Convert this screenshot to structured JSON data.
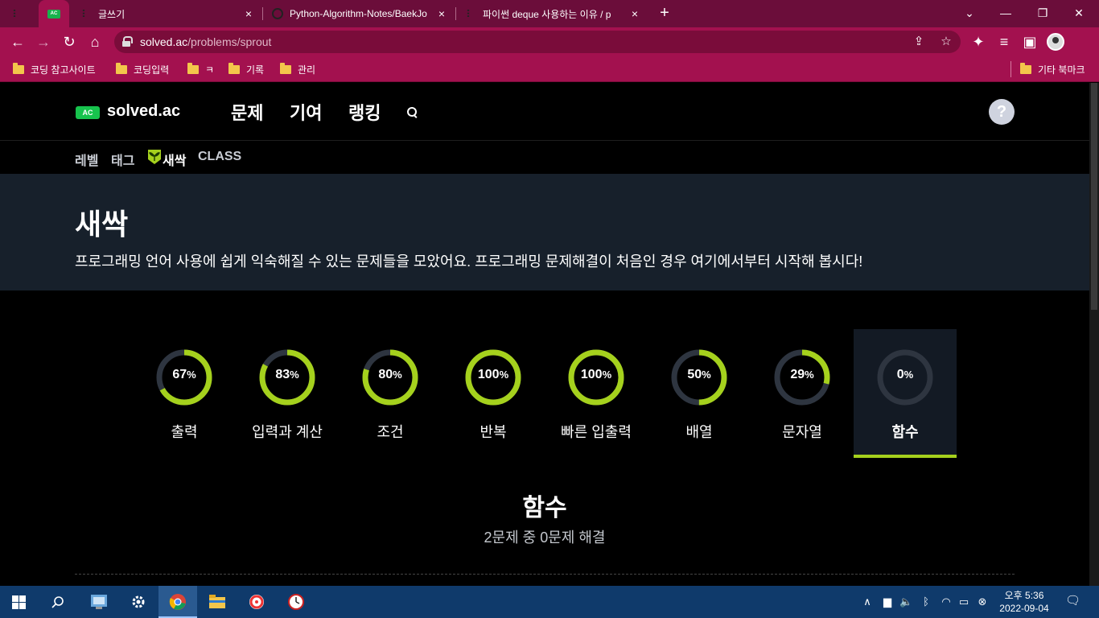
{
  "browser": {
    "tabs": [
      {
        "title": "",
        "favicon": "tistory-icon"
      },
      {
        "title": "",
        "favicon": "solvedac-icon",
        "active": true
      },
      {
        "title": "글쓰기",
        "favicon": "tistory-icon"
      },
      {
        "title": "Python-Algorithm-Notes/BaekJo",
        "favicon": "github-icon"
      },
      {
        "title": "파이썬 deque 사용하는 이유 / p",
        "favicon": "tistory-icon"
      }
    ],
    "url_host": "solved.ac",
    "url_path": "/problems/sprout",
    "bookmarks": [
      "코딩 참고사이트",
      "코딩입력",
      "ㅋ",
      "기록",
      "관리"
    ],
    "other_bookmarks": "기타 북마크"
  },
  "site": {
    "logo_badge": "AC",
    "logo_text": "solved.ac",
    "nav": [
      "문제",
      "기여",
      "랭킹"
    ],
    "help": "?",
    "subnav": [
      "레벨",
      "태그",
      "새싹",
      "CLASS"
    ]
  },
  "hero": {
    "title": "새싹",
    "description": "프로그래밍 언어 사용에 쉽게 익숙해질 수 있는 문제들을 모았어요. 프로그래밍 문제해결이 처음인 경우 여기에서부터 시작해 봅시다!"
  },
  "categories": [
    {
      "label": "출력",
      "percent": 67
    },
    {
      "label": "입력과 계산",
      "percent": 83
    },
    {
      "label": "조건",
      "percent": 80
    },
    {
      "label": "반복",
      "percent": 100
    },
    {
      "label": "빠른 입출력",
      "percent": 100
    },
    {
      "label": "배열",
      "percent": 50
    },
    {
      "label": "문자열",
      "percent": 29
    },
    {
      "label": "함수",
      "percent": 0,
      "active": true
    }
  ],
  "colors": {
    "accent": "#a5d11d",
    "ring_track": "#2e3540",
    "brand": "#17c34d"
  },
  "section": {
    "title": "함수",
    "subtitle": "2문제 중 0문제 해결"
  },
  "taskbar": {
    "time": "오후 5:36",
    "date": "2022-09-04"
  }
}
